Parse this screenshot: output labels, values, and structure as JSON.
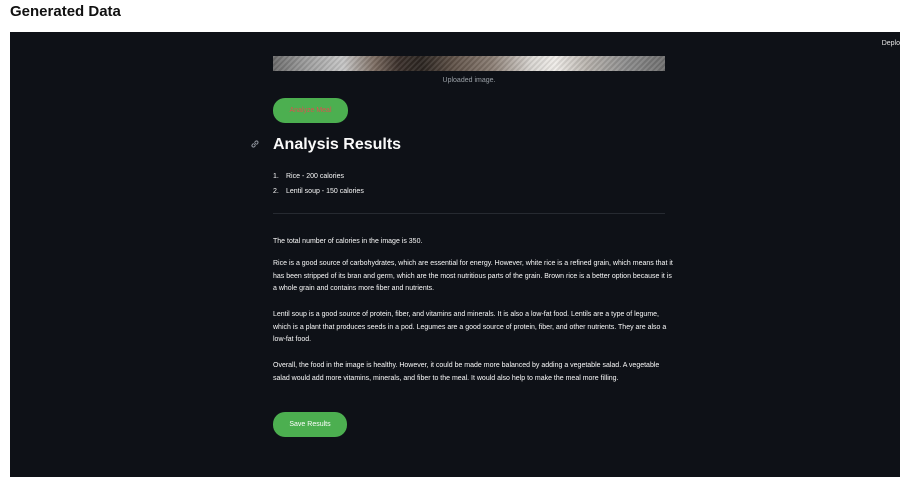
{
  "page": {
    "heading": "Generated Data"
  },
  "header": {
    "deploy_label": "Deplo"
  },
  "image": {
    "caption": "Uploaded image."
  },
  "analyze_button": {
    "label": "Analyze Meal"
  },
  "results": {
    "title": "Analysis Results",
    "items": [
      {
        "number": "1.",
        "text": "Rice - 200 calories"
      },
      {
        "number": "2.",
        "text": "Lentil soup - 150 calories"
      }
    ],
    "paragraphs": [
      "The total number of calories in the image is 350.",
      "Rice is a good source of carbohydrates, which are essential for energy. However, white rice is a refined grain, which means that it has been stripped of its bran and germ, which are the most nutritious parts of the grain. Brown rice is a better option because it is a whole grain and contains more fiber and nutrients.",
      "Lentil soup is a good source of protein, fiber, and vitamins and minerals. It is also a low-fat food. Lentils are a type of legume, which is a plant that produces seeds in a pod. Legumes are a good source of protein, fiber, and other nutrients. They are also a low-fat food.",
      "Overall, the food in the image is healthy. However, it could be made more balanced by adding a vegetable salad. A vegetable salad would add more vitamins, minerals, and fiber to the meal. It would also help to make the meal more filling."
    ]
  },
  "save_button": {
    "label": "Save Results"
  },
  "colors": {
    "app_background": "#0e1117",
    "button_green": "#4caf50",
    "analyze_text": "#d9534f"
  },
  "icons": {
    "heading_anchor": "link-icon"
  }
}
